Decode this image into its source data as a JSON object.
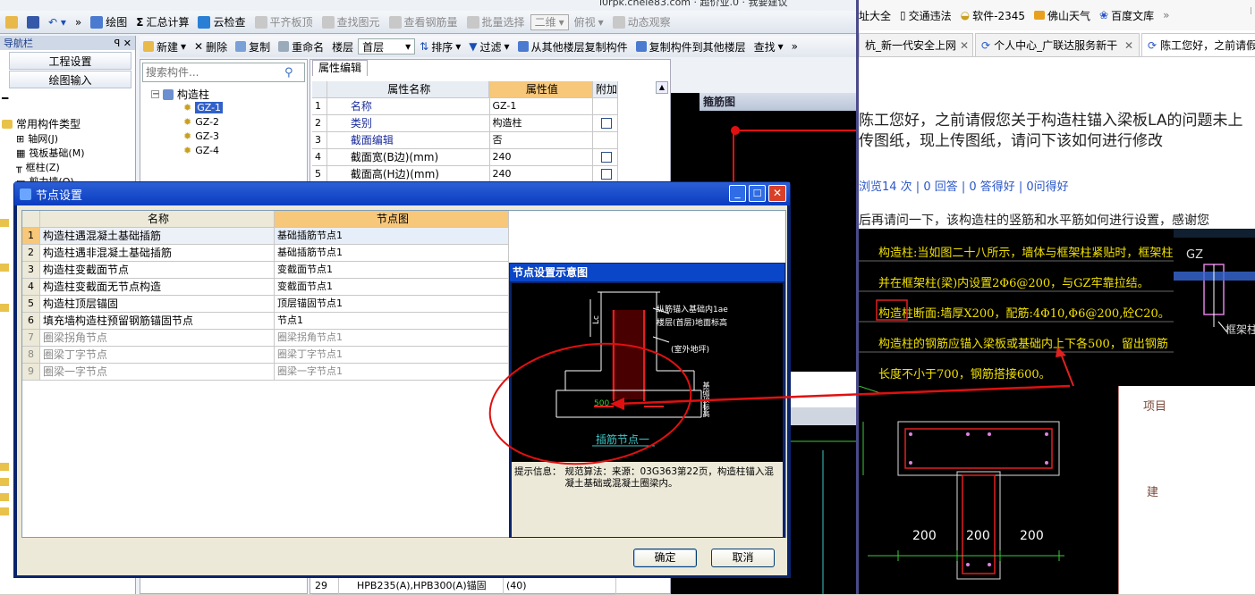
{
  "app": {
    "toolbar1": [
      {
        "label": "绘图",
        "enabled": true
      },
      {
        "label": "汇总计算",
        "enabled": true
      },
      {
        "label": "云检查",
        "enabled": true
      },
      {
        "label": "平齐板顶",
        "enabled": false
      },
      {
        "label": "查找图元",
        "enabled": false
      },
      {
        "label": "查看钢筋量",
        "enabled": false
      },
      {
        "label": "批量选择",
        "enabled": false
      },
      {
        "label": "二维",
        "enabled": false
      },
      {
        "label": "俯视",
        "enabled": false
      },
      {
        "label": "动态观察",
        "enabled": false
      }
    ],
    "top_overflow_text": "i0rpk.cnele83.com · 超价业.0 · 我要建议",
    "nav": {
      "title": "导航栏",
      "project_settings": "工程设置",
      "drawing_input": "绘图输入",
      "common_types": "常用构件类型",
      "items": [
        "轴网(J)",
        "筏板基础(M)",
        "框柱(Z)",
        "剪力墙(Q)"
      ]
    },
    "toolbar2": [
      "新建",
      "删除",
      "复制",
      "重命名",
      "楼层",
      "首层",
      "排序",
      "过滤",
      "从其他楼层复制构件",
      "复制构件到其他楼层",
      "查找"
    ],
    "search_placeholder": "搜索构件...",
    "tree": {
      "root": "构造柱",
      "children": [
        "GZ-1",
        "GZ-2",
        "GZ-3",
        "GZ-4"
      ]
    },
    "prop_tab": "属性编辑",
    "prop_headers": [
      "属性名称",
      "属性值",
      "附加"
    ],
    "props": [
      {
        "n": "1",
        "name": "名称",
        "value": "GZ-1",
        "check": false
      },
      {
        "n": "2",
        "name": "类别",
        "value": "构造柱",
        "check": true
      },
      {
        "n": "3",
        "name": "截面编辑",
        "value": "否",
        "check": false
      },
      {
        "n": "4",
        "name": "截面宽(B边)(mm)",
        "value": "240",
        "check": true
      },
      {
        "n": "5",
        "name": "截面高(H边)(mm)",
        "value": "240",
        "check": true
      }
    ],
    "prop_bottom": {
      "n": "29",
      "name": "HPB235(A),HPB300(A)锚固",
      "value": "(40)"
    },
    "rebar_panel_title": "箍筋图"
  },
  "dialog": {
    "title": "节点设置",
    "headers": [
      "名称",
      "节点图"
    ],
    "rows": [
      {
        "n": "1",
        "name": "构造柱遇混凝土基础插筋",
        "node": "基础插筋节点1",
        "enabled": true
      },
      {
        "n": "2",
        "name": "构造柱遇非混凝土基础插筋",
        "node": "基础插筋节点1",
        "enabled": true
      },
      {
        "n": "3",
        "name": "构造柱变截面节点",
        "node": "变截面节点1",
        "enabled": true
      },
      {
        "n": "4",
        "name": "构造柱变截面无节点构造",
        "node": "变截面节点1",
        "enabled": true
      },
      {
        "n": "5",
        "name": "构造柱顶层锚固",
        "node": "顶层锚固节点1",
        "enabled": true
      },
      {
        "n": "6",
        "name": "填充墙构造柱预留钢筋锚固节点",
        "node": "节点1",
        "enabled": true
      },
      {
        "n": "7",
        "name": "圈梁拐角节点",
        "node": "圈梁拐角节点1",
        "enabled": false
      },
      {
        "n": "8",
        "name": "圈梁丁字节点",
        "node": "圈梁丁字节点1",
        "enabled": false
      },
      {
        "n": "9",
        "name": "圈梁一字节点",
        "node": "圈梁一字节点1",
        "enabled": false
      }
    ],
    "diagram_title": "节点设置示意图",
    "diagram_labels": {
      "l1": "纵筋锚入基础内1ae",
      "l2": "楼层(首层)地面标高",
      "l3": "(室外地坪)",
      "lc": "Lc",
      "v500": "500",
      "bottom": "插筋节点一",
      "side": "基础顶标高"
    },
    "hint_label": "提示信息：",
    "hint_text": "规范算法：来源：03G363第22页，构造柱锚入混凝土基础或混凝土圈梁内。",
    "ok": "确定",
    "cancel": "取消"
  },
  "browser": {
    "bookmarks": [
      "址大全",
      "交通违法",
      "软件-2345",
      "佛山天气",
      "百度文库"
    ],
    "tabs": [
      "杭_新一代安全上网",
      "个人中心_广联达服务新干",
      "陈工您好，之前请假"
    ],
    "question_title": "陈工您好，之前请假您关于构造柱锚入梁板LA的问题未上传图纸，现上传图纸，请问下该如何进行修改",
    "stats": "浏览14 次 | 0 回答 | 0 答得好 | 0问得好",
    "body_text": "后再请问一下，该构造柱的竖筋和水平筋如何进行设置，感谢您",
    "note_lines": [
      "构造柱:当如图二十八所示，墙体与框架柱紧贴时，框架柱位置应设GZ，",
      "并在框架柱(梁)内设置2Φ6@200，与GZ牢靠拉结。",
      "构造柱断面:墙厚X200，配筋:4Φ10,Φ6@200,砼C20。",
      "构造柱的钢筋应锚入梁板或基础内上下各500，留出钢筋",
      "长度不小于700，钢筋搭接600。"
    ],
    "gz_label": "GZ",
    "frame_col_label": "框架柱",
    "dims": [
      "200",
      "200",
      "200"
    ],
    "project_label": "项目",
    "build_label": "建"
  }
}
